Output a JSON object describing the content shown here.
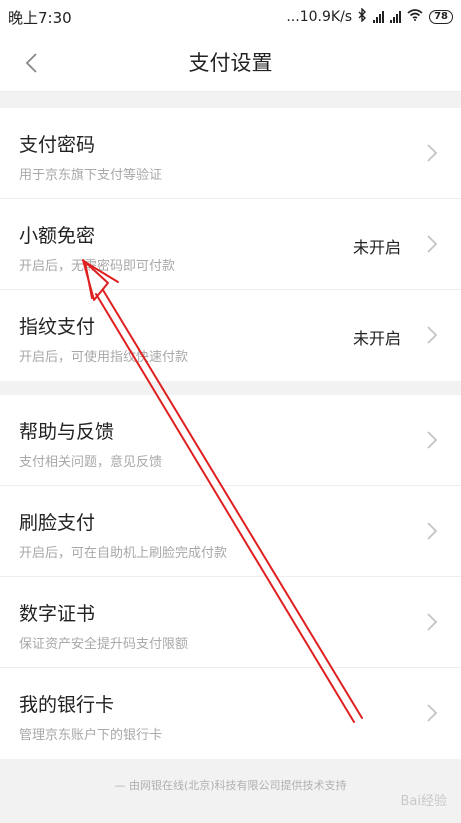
{
  "status_bar": {
    "time": "晚上7:30",
    "network_speed": "...10.9K/s",
    "battery": "78"
  },
  "nav": {
    "title": "支付设置",
    "back_icon": "chevron-left-icon"
  },
  "section1": [
    {
      "title": "支付密码",
      "subtitle": "用于京东旗下支付等验证",
      "status": ""
    },
    {
      "title": "小额免密",
      "subtitle": "开启后，无需密码即可付款",
      "status": "未开启"
    },
    {
      "title": "指纹支付",
      "subtitle": "开启后，可使用指纹快速付款",
      "status": "未开启"
    }
  ],
  "section2": [
    {
      "title": "帮助与反馈",
      "subtitle": "支付相关问题，意见反馈"
    },
    {
      "title": "刷脸支付",
      "subtitle": "开启后，可在自助机上刷脸完成付款"
    },
    {
      "title": "数字证书",
      "subtitle": "保证资产安全提升码支付限额"
    },
    {
      "title": "我的银行卡",
      "subtitle": "管理京东账户下的银行卡"
    }
  ],
  "footer": {
    "text": "— 由网银在线(北京)科技有限公司提供技术支持"
  },
  "watermark": "Bai经验",
  "colors": {
    "annotation_arrow": "#e02020",
    "background": "#f2f2f2",
    "subtitle": "#a8a8a8"
  }
}
